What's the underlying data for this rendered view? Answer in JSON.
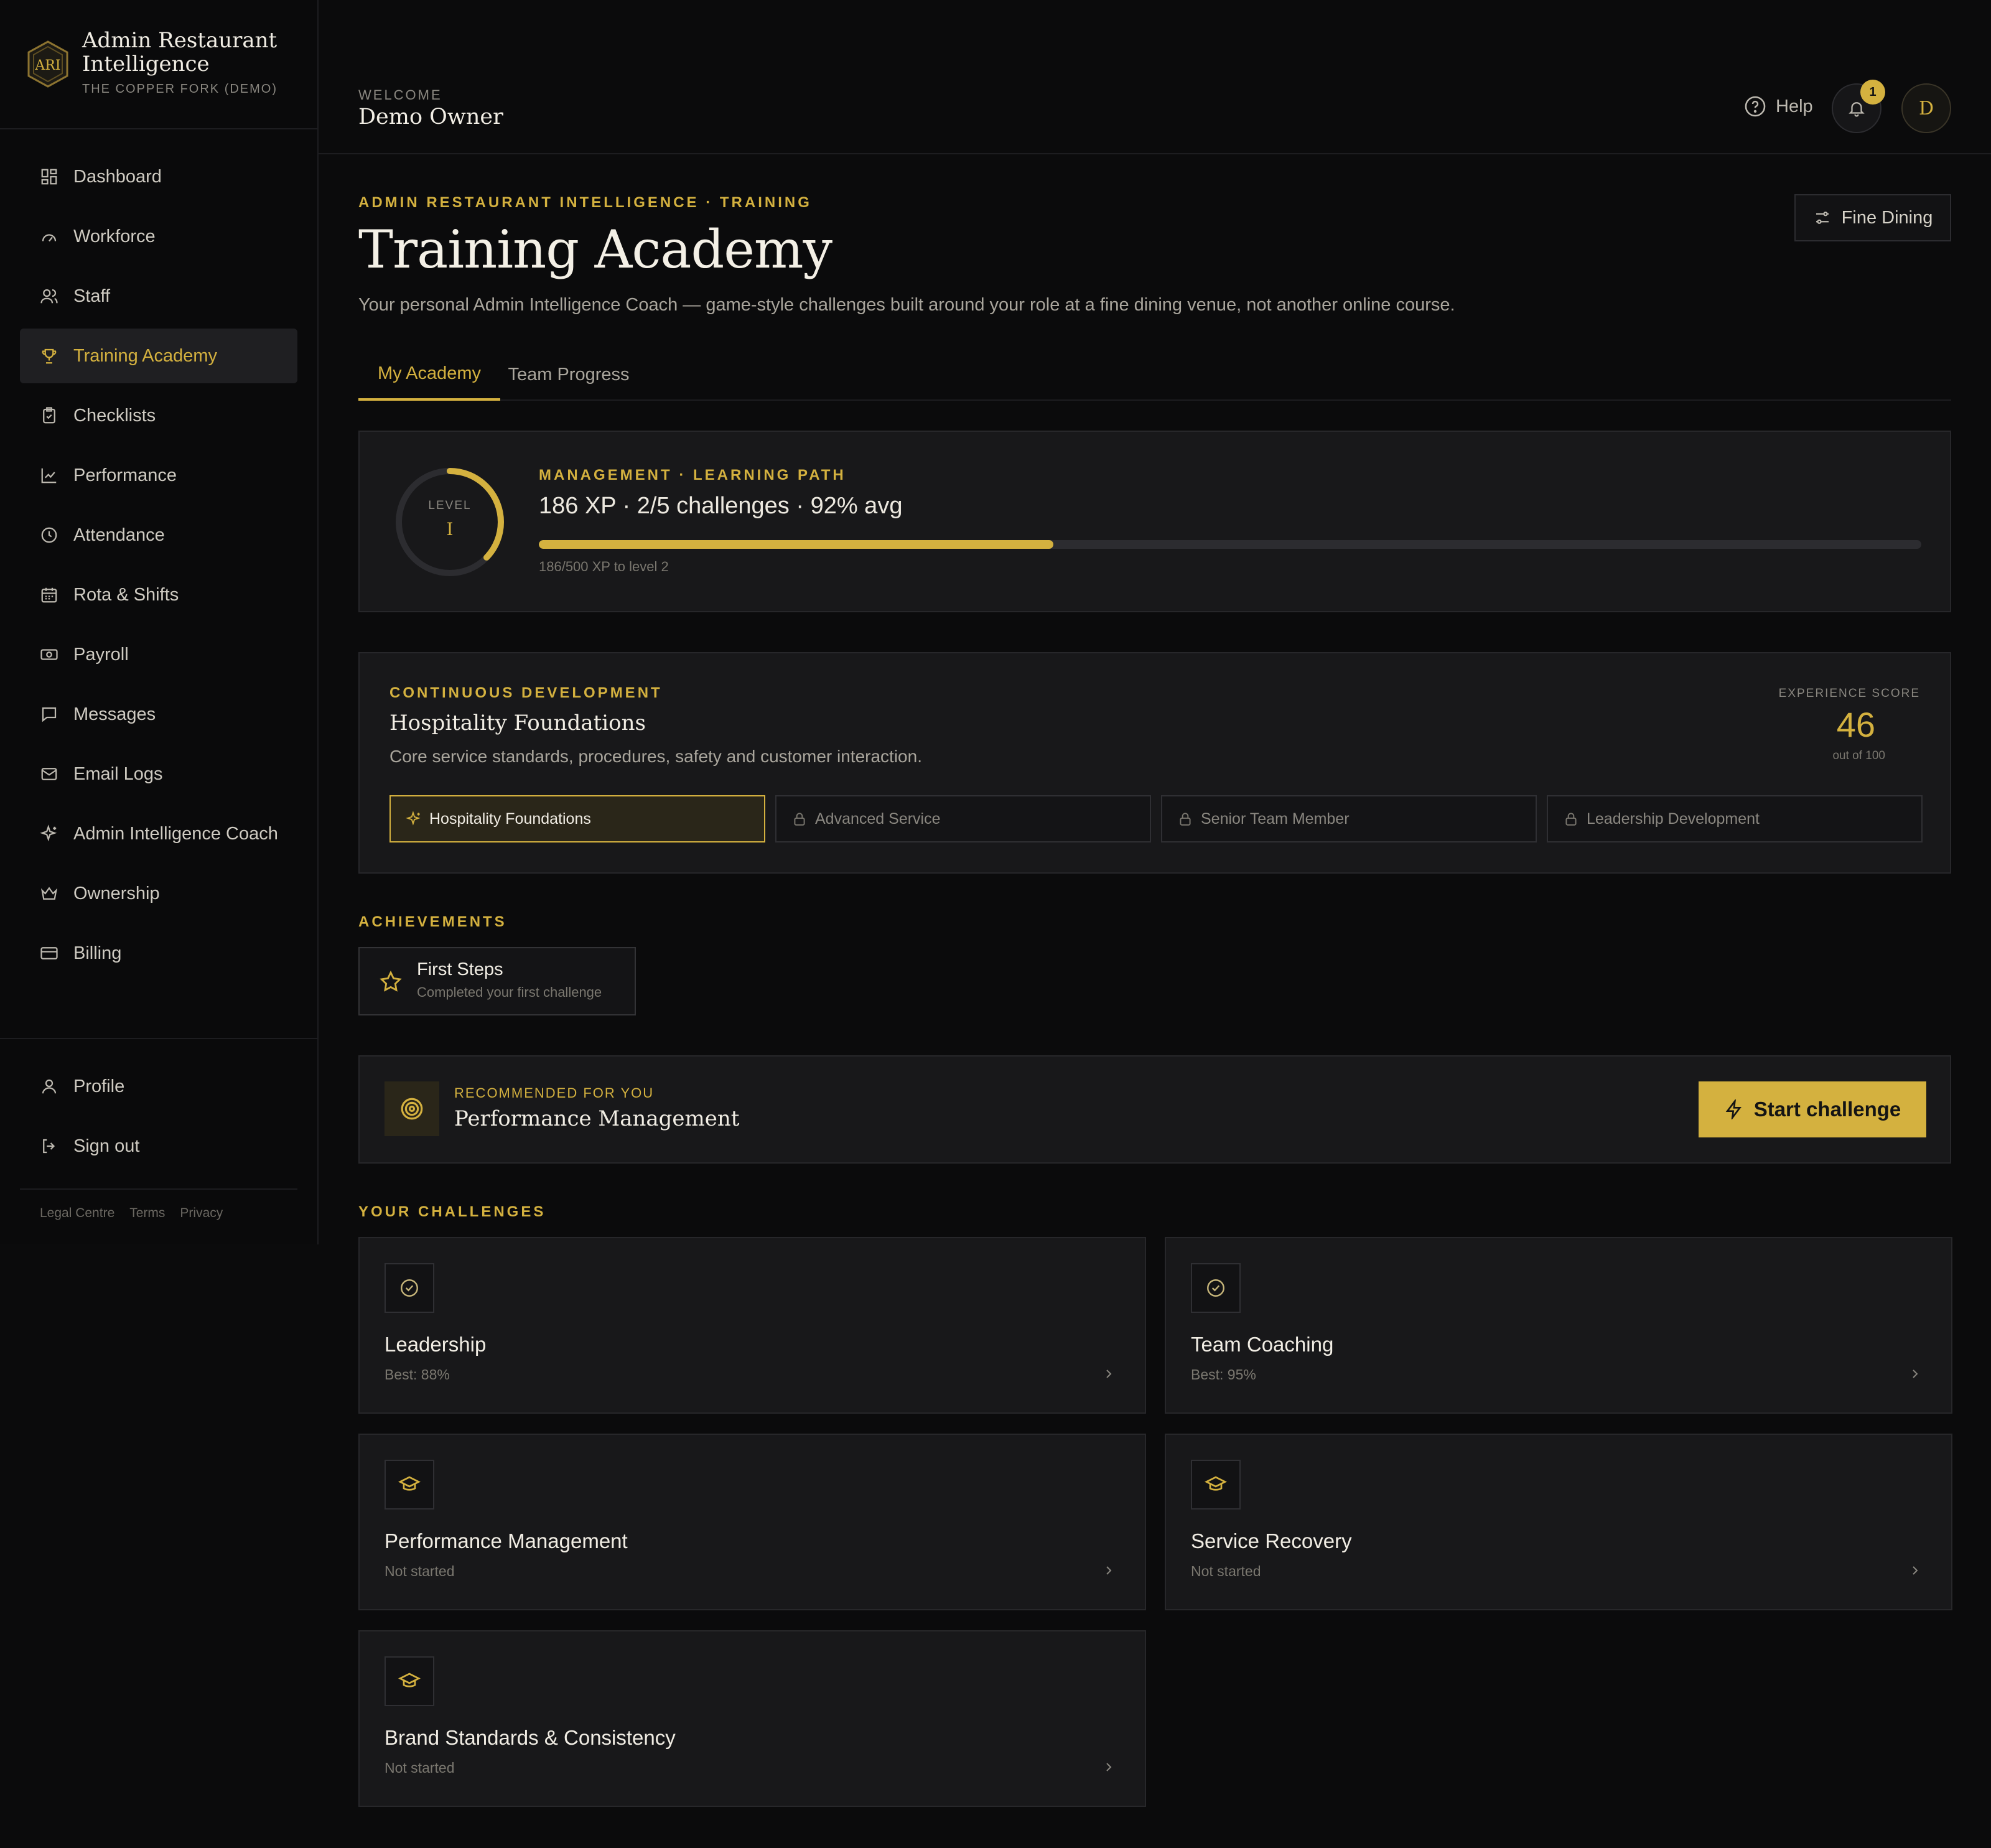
{
  "brand": {
    "name": "Admin Restaurant Intelligence",
    "venue": "THE COPPER FORK (DEMO)",
    "logo_text": "ARI"
  },
  "sidebar": {
    "items": [
      {
        "label": "Dashboard",
        "icon": "dashboard-icon"
      },
      {
        "label": "Workforce",
        "icon": "gauge-icon"
      },
      {
        "label": "Staff",
        "icon": "users-icon"
      },
      {
        "label": "Training Academy",
        "icon": "trophy-icon",
        "active": true
      },
      {
        "label": "Checklists",
        "icon": "clipboard-icon"
      },
      {
        "label": "Performance",
        "icon": "line-chart-icon"
      },
      {
        "label": "Attendance",
        "icon": "clock-icon"
      },
      {
        "label": "Rota & Shifts",
        "icon": "calendar-icon"
      },
      {
        "label": "Payroll",
        "icon": "banknote-icon"
      },
      {
        "label": "Messages",
        "icon": "message-icon"
      },
      {
        "label": "Email Logs",
        "icon": "mail-icon"
      },
      {
        "label": "Admin Intelligence Coach",
        "icon": "sparkle-icon"
      },
      {
        "label": "Ownership",
        "icon": "crown-icon"
      },
      {
        "label": "Billing",
        "icon": "credit-card-icon"
      }
    ],
    "bottom": [
      {
        "label": "Profile",
        "icon": "user-icon"
      },
      {
        "label": "Sign out",
        "icon": "sign-out-icon"
      }
    ],
    "legal": [
      "Legal Centre",
      "Terms",
      "Privacy"
    ]
  },
  "header": {
    "welcome_label": "WELCOME",
    "user_name": "Demo Owner",
    "help_label": "Help",
    "notification_count": "1",
    "avatar_initial": "D"
  },
  "page": {
    "breadcrumb": "ADMIN RESTAURANT INTELLIGENCE · TRAINING",
    "title": "Training Academy",
    "subtitle": "Your personal Admin Intelligence Coach — game-style challenges built around your role at a fine dining venue, not another online course.",
    "venue_filter": "Fine Dining",
    "tabs": [
      {
        "label": "My Academy",
        "active": true
      },
      {
        "label": "Team Progress",
        "active": false
      }
    ]
  },
  "level": {
    "ring_label": "LEVEL",
    "level_numeral": "I",
    "ring_progress": 0.372,
    "path_label": "MANAGEMENT · LEARNING PATH",
    "stats": "186 XP · 2/5 challenges · 92% avg",
    "xp_current": 186,
    "xp_target": 500,
    "xp_text": "186/500 XP to level 2"
  },
  "development": {
    "label": "CONTINUOUS DEVELOPMENT",
    "title": "Hospitality Foundations",
    "description": "Core service standards, procedures, safety and customer interaction.",
    "score_label": "EXPERIENCE SCORE",
    "score": "46",
    "score_out_of": "out of 100",
    "levels": [
      {
        "label": "Hospitality Foundations",
        "state": "active"
      },
      {
        "label": "Advanced Service",
        "state": "locked"
      },
      {
        "label": "Senior Team Member",
        "state": "locked"
      },
      {
        "label": "Leadership Development",
        "state": "locked"
      }
    ]
  },
  "achievements": {
    "heading": "ACHIEVEMENTS",
    "items": [
      {
        "title": "First Steps",
        "description": "Completed your first challenge"
      }
    ]
  },
  "recommended": {
    "label": "RECOMMENDED FOR YOU",
    "title": "Performance Management",
    "button_label": "Start challenge"
  },
  "challenges": {
    "heading": "YOUR CHALLENGES",
    "items": [
      {
        "title": "Leadership",
        "status": "Best: 88%",
        "icon": "check-circle-icon"
      },
      {
        "title": "Team Coaching",
        "status": "Best: 95%",
        "icon": "check-circle-icon"
      },
      {
        "title": "Performance Management",
        "status": "Not started",
        "icon": "graduation-cap-icon"
      },
      {
        "title": "Service Recovery",
        "status": "Not started",
        "icon": "graduation-cap-icon"
      },
      {
        "title": "Brand Standards & Consistency",
        "status": "Not started",
        "icon": "graduation-cap-icon"
      }
    ]
  },
  "colors": {
    "accent": "#d4b13f",
    "background": "#0b0b0c",
    "card": "#18181a",
    "border": "#27272a"
  }
}
